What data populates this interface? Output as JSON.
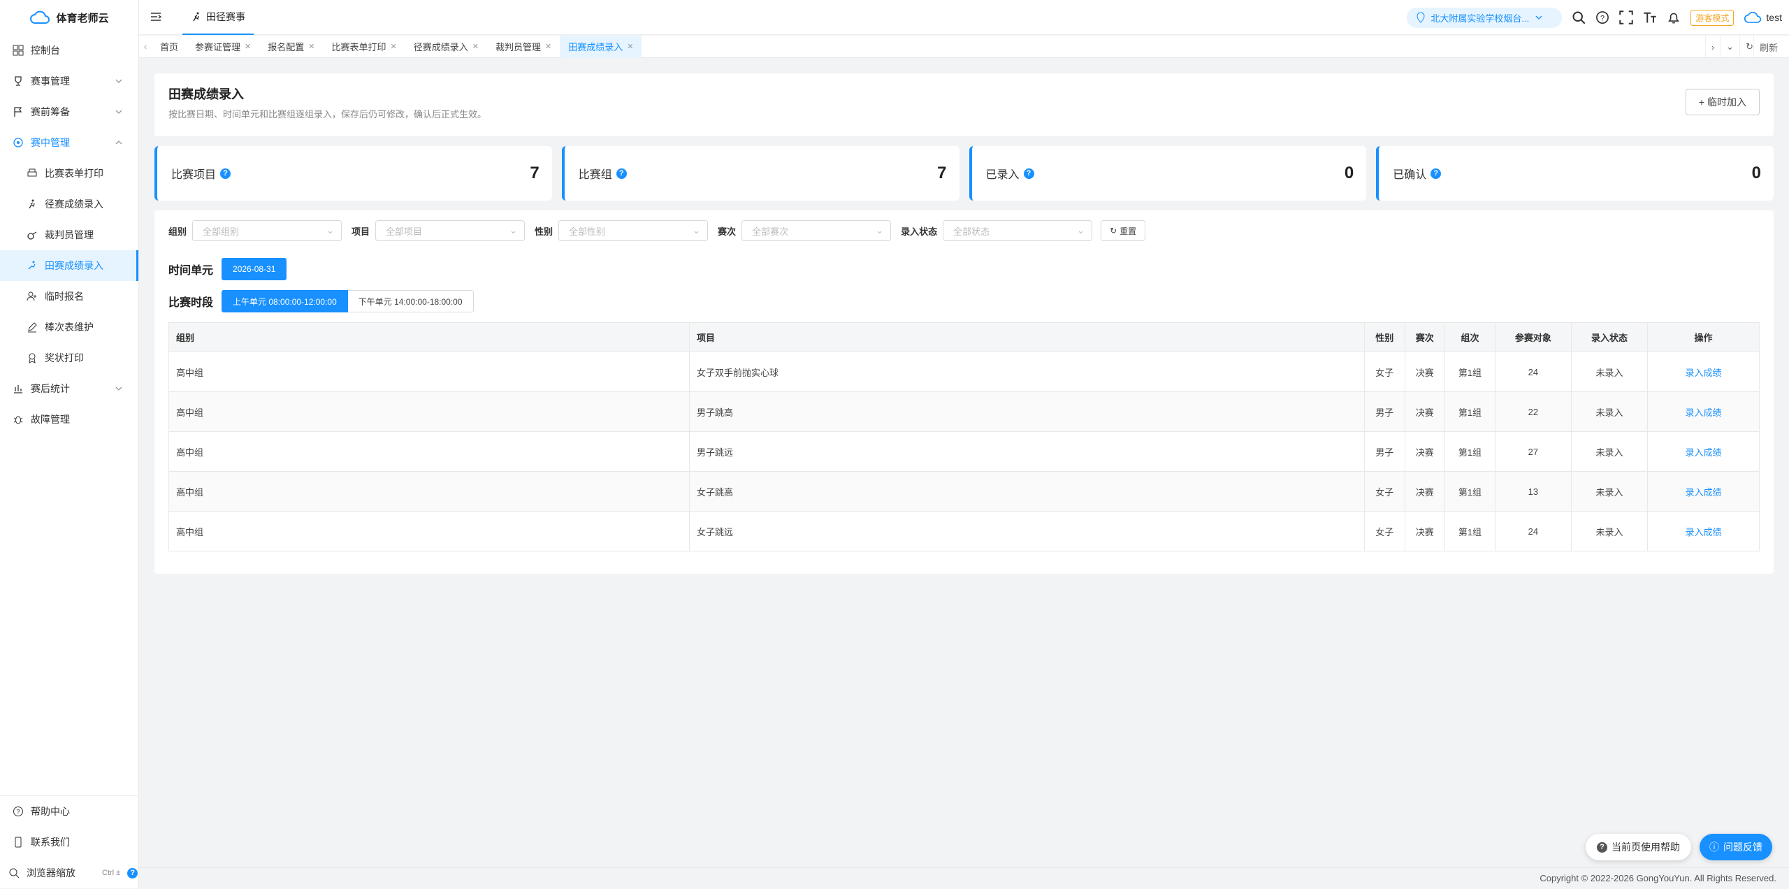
{
  "app": {
    "name": "体育老师云",
    "user": "test",
    "visitor_badge": "游客模式"
  },
  "topbar": {
    "module": "田径赛事",
    "school": "北大附属实验学校烟台..."
  },
  "sidebar": {
    "items": [
      {
        "label": "控制台"
      },
      {
        "label": "赛事管理"
      },
      {
        "label": "赛前筹备"
      },
      {
        "label": "赛中管理"
      },
      {
        "label": "赛后统计"
      },
      {
        "label": "故障管理"
      }
    ],
    "sub_items": [
      {
        "label": "比赛表单打印"
      },
      {
        "label": "径赛成绩录入"
      },
      {
        "label": "裁判员管理"
      },
      {
        "label": "田赛成绩录入"
      },
      {
        "label": "临时报名"
      },
      {
        "label": "棒次表维护"
      },
      {
        "label": "奖状打印"
      }
    ],
    "bottom": [
      {
        "label": "帮助中心"
      },
      {
        "label": "联系我们"
      },
      {
        "label": "浏览器缩放",
        "hint": "Ctrl ±"
      }
    ]
  },
  "tabs": [
    {
      "label": "首页"
    },
    {
      "label": "参赛证管理"
    },
    {
      "label": "报名配置"
    },
    {
      "label": "比赛表单打印"
    },
    {
      "label": "径赛成绩录入"
    },
    {
      "label": "裁判员管理"
    },
    {
      "label": "田赛成绩录入"
    }
  ],
  "tabs_refresh": "刷新",
  "page": {
    "title": "田赛成绩录入",
    "subtitle": "按比赛日期、时间单元和比赛组逐组录入，保存后仍可修改，确认后正式生效。",
    "temp_add": "临时加入"
  },
  "stats": [
    {
      "label": "比赛项目",
      "value": "7"
    },
    {
      "label": "比赛组",
      "value": "7"
    },
    {
      "label": "已录入",
      "value": "0"
    },
    {
      "label": "已确认",
      "value": "0"
    }
  ],
  "filters": [
    {
      "label": "组别",
      "placeholder": "全部组别"
    },
    {
      "label": "项目",
      "placeholder": "全部项目"
    },
    {
      "label": "性别",
      "placeholder": "全部性别"
    },
    {
      "label": "赛次",
      "placeholder": "全部赛次"
    },
    {
      "label": "录入状态",
      "placeholder": "全部状态"
    }
  ],
  "reset_label": "重置",
  "time_unit": {
    "label": "时间单元",
    "date": "2026-08-31"
  },
  "period": {
    "label": "比赛时段",
    "options": [
      "上午单元 08:00:00-12:00:00",
      "下午单元 14:00:00-18:00:00"
    ]
  },
  "table": {
    "headers": [
      "组别",
      "项目",
      "性别",
      "赛次",
      "组次",
      "参赛对象",
      "录入状态",
      "操作"
    ],
    "rows": [
      [
        "高中组",
        "女子双手前抛实心球",
        "女子",
        "决赛",
        "第1组",
        "24",
        "未录入",
        "录入成绩"
      ],
      [
        "高中组",
        "男子跳高",
        "男子",
        "决赛",
        "第1组",
        "22",
        "未录入",
        "录入成绩"
      ],
      [
        "高中组",
        "男子跳远",
        "男子",
        "决赛",
        "第1组",
        "27",
        "未录入",
        "录入成绩"
      ],
      [
        "高中组",
        "女子跳高",
        "女子",
        "决赛",
        "第1组",
        "13",
        "未录入",
        "录入成绩"
      ],
      [
        "高中组",
        "女子跳远",
        "女子",
        "决赛",
        "第1组",
        "24",
        "未录入",
        "录入成绩"
      ]
    ]
  },
  "footer": "Copyright © 2022-2026 GongYouYun. All Rights Reserved.",
  "float": {
    "help": "当前页使用帮助",
    "feedback": "问题反馈"
  },
  "colors": {
    "accent": "#1890ff",
    "visitor": "#f5a623"
  }
}
